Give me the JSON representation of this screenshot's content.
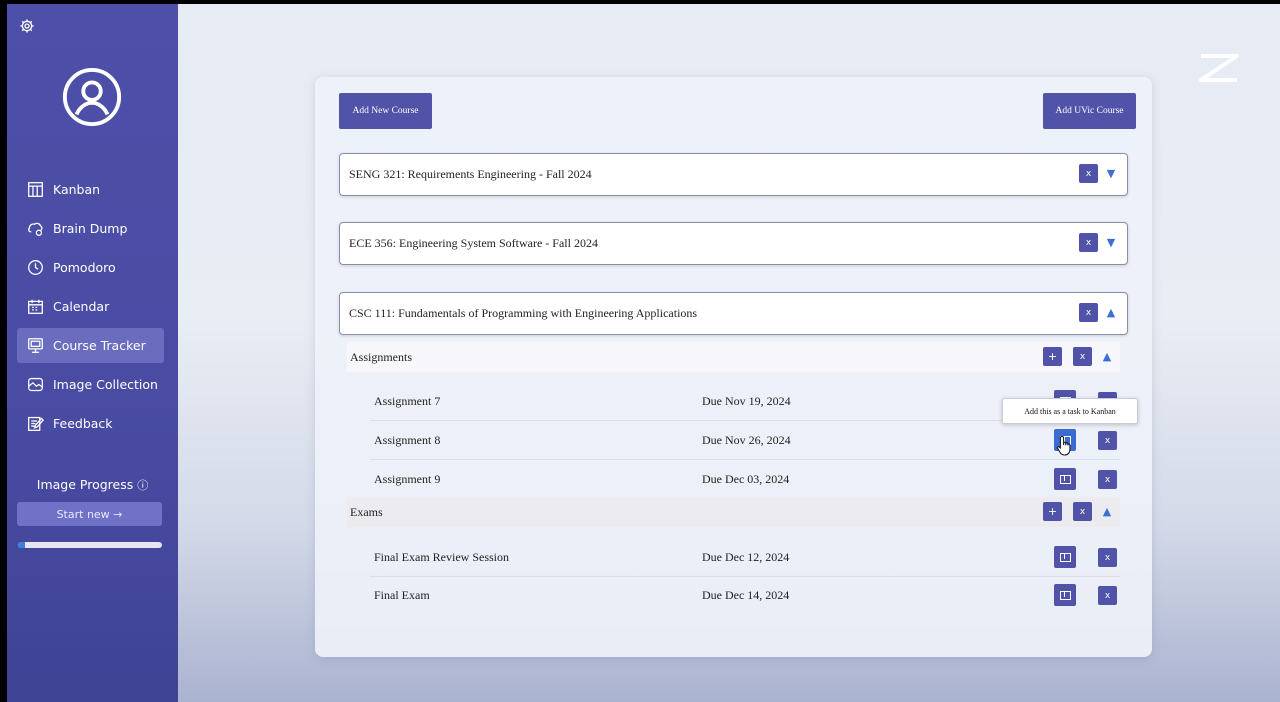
{
  "sidebar": {
    "nav": [
      {
        "label": "Kanban",
        "icon": "kanban-icon"
      },
      {
        "label": "Brain Dump",
        "icon": "brain-icon"
      },
      {
        "label": "Pomodoro",
        "icon": "clock-icon"
      },
      {
        "label": "Calendar",
        "icon": "calendar-icon"
      },
      {
        "label": "Course Tracker",
        "icon": "monitor-icon",
        "active": true
      },
      {
        "label": "Image Collection",
        "icon": "image-icon"
      },
      {
        "label": "Feedback",
        "icon": "feedback-icon"
      }
    ],
    "image_progress_label": "Image Progress",
    "info_glyph": "ⓘ",
    "start_new_label": "Start new →",
    "progress_fraction": 0.05
  },
  "panel": {
    "add_new_course_label": "Add New Course",
    "add_uvic_course_label": "Add UVic Course",
    "courses": [
      {
        "title": "SENG 321: Requirements Engineering - Fall 2024",
        "expanded": false
      },
      {
        "title": "ECE 356: Engineering System Software - Fall 2024",
        "expanded": false
      },
      {
        "title": "CSC 111: Fundamentals of Programming with Engineering Applications",
        "expanded": true
      }
    ],
    "sections": [
      {
        "title": "Assignments",
        "items": [
          {
            "name": "Assignment 7",
            "due": "Due Nov 19, 2024"
          },
          {
            "name": "Assignment 8",
            "due": "Due Nov 26, 2024"
          },
          {
            "name": "Assignment 9",
            "due": "Due Dec 03, 2024"
          }
        ]
      },
      {
        "title": "Exams",
        "items": [
          {
            "name": "Final Exam Review Session",
            "due": "Due Dec 12, 2024"
          },
          {
            "name": "Final Exam",
            "due": "Due Dec 14, 2024"
          }
        ]
      }
    ],
    "tooltip": "Add this as a task to Kanban",
    "remove_glyph": "x",
    "add_glyph": "+",
    "collapse_glyph": "▼",
    "expand_glyph": "▲"
  },
  "colors": {
    "sidebar": "#4d4fa8",
    "accent": "#5153a8",
    "arrow": "#3d6fd6",
    "hover": "#3b6bd1"
  }
}
